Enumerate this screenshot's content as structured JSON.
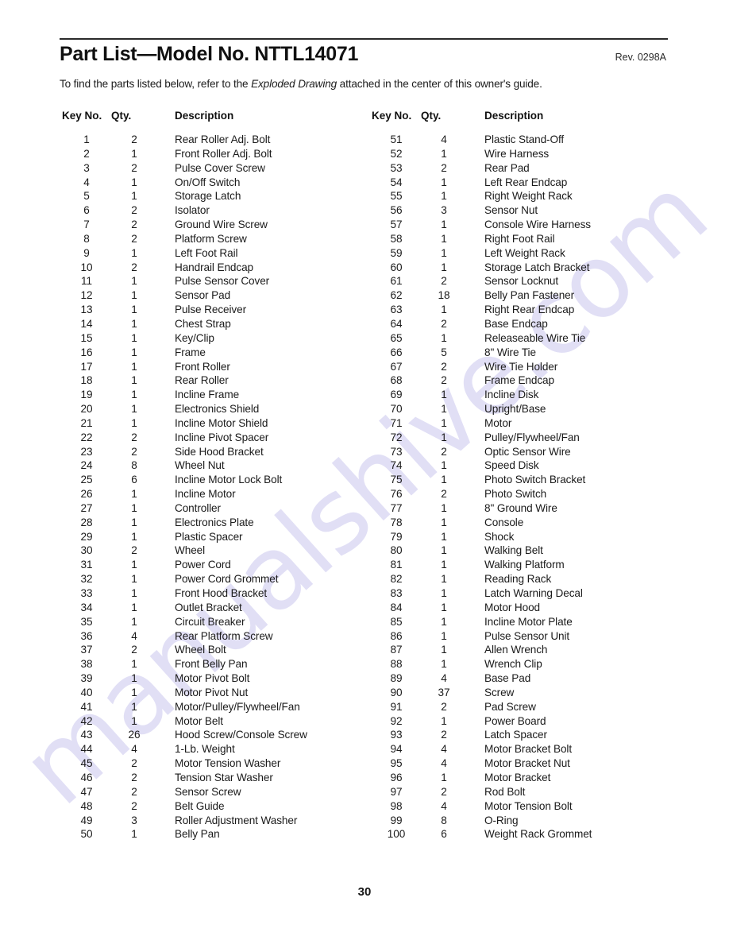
{
  "document": {
    "title": "Part List—Model No. NTTL14071",
    "revision": "Rev. 0298A",
    "intro_before": "To find the parts listed below, refer to the ",
    "intro_italic": "Exploded Drawing",
    "intro_after": " attached in the center of this owner's guide.",
    "page_number": "30",
    "watermark": "manualshive.com"
  },
  "table": {
    "headers": {
      "key_no": "Key No.",
      "qty": "Qty.",
      "description": "Description"
    },
    "left_column": [
      {
        "key": "1",
        "qty": "2",
        "desc": "Rear Roller Adj. Bolt"
      },
      {
        "key": "2",
        "qty": "1",
        "desc": "Front Roller Adj. Bolt"
      },
      {
        "key": "3",
        "qty": "2",
        "desc": "Pulse Cover Screw"
      },
      {
        "key": "4",
        "qty": "1",
        "desc": "On/Off Switch"
      },
      {
        "key": "5",
        "qty": "1",
        "desc": "Storage Latch"
      },
      {
        "key": "6",
        "qty": "2",
        "desc": "Isolator"
      },
      {
        "key": "7",
        "qty": "2",
        "desc": "Ground Wire Screw"
      },
      {
        "key": "8",
        "qty": "2",
        "desc": "Platform Screw"
      },
      {
        "key": "9",
        "qty": "1",
        "desc": "Left Foot Rail"
      },
      {
        "key": "10",
        "qty": "2",
        "desc": "Handrail Endcap"
      },
      {
        "key": "11",
        "qty": "1",
        "desc": "Pulse Sensor Cover"
      },
      {
        "key": "12",
        "qty": "1",
        "desc": "Sensor Pad"
      },
      {
        "key": "13",
        "qty": "1",
        "desc": "Pulse Receiver"
      },
      {
        "key": "14",
        "qty": "1",
        "desc": "Chest Strap"
      },
      {
        "key": "15",
        "qty": "1",
        "desc": "Key/Clip"
      },
      {
        "key": "16",
        "qty": "1",
        "desc": "Frame"
      },
      {
        "key": "17",
        "qty": "1",
        "desc": "Front Roller"
      },
      {
        "key": "18",
        "qty": "1",
        "desc": "Rear Roller"
      },
      {
        "key": "19",
        "qty": "1",
        "desc": "Incline Frame"
      },
      {
        "key": "20",
        "qty": "1",
        "desc": "Electronics Shield"
      },
      {
        "key": "21",
        "qty": "1",
        "desc": "Incline Motor Shield"
      },
      {
        "key": "22",
        "qty": "2",
        "desc": "Incline Pivot Spacer"
      },
      {
        "key": "23",
        "qty": "2",
        "desc": "Side Hood Bracket"
      },
      {
        "key": "24",
        "qty": "8",
        "desc": "Wheel Nut"
      },
      {
        "key": "25",
        "qty": "6",
        "desc": "Incline Motor Lock Bolt"
      },
      {
        "key": "26",
        "qty": "1",
        "desc": "Incline Motor"
      },
      {
        "key": "27",
        "qty": "1",
        "desc": "Controller"
      },
      {
        "key": "28",
        "qty": "1",
        "desc": "Electronics Plate"
      },
      {
        "key": "29",
        "qty": "1",
        "desc": "Plastic Spacer"
      },
      {
        "key": "30",
        "qty": "2",
        "desc": "Wheel"
      },
      {
        "key": "31",
        "qty": "1",
        "desc": "Power Cord"
      },
      {
        "key": "32",
        "qty": "1",
        "desc": "Power Cord Grommet"
      },
      {
        "key": "33",
        "qty": "1",
        "desc": "Front Hood Bracket"
      },
      {
        "key": "34",
        "qty": "1",
        "desc": "Outlet Bracket"
      },
      {
        "key": "35",
        "qty": "1",
        "desc": "Circuit Breaker"
      },
      {
        "key": "36",
        "qty": "4",
        "desc": "Rear Platform Screw"
      },
      {
        "key": "37",
        "qty": "2",
        "desc": "Wheel Bolt"
      },
      {
        "key": "38",
        "qty": "1",
        "desc": "Front Belly Pan"
      },
      {
        "key": "39",
        "qty": "1",
        "desc": "Motor Pivot Bolt"
      },
      {
        "key": "40",
        "qty": "1",
        "desc": "Motor Pivot Nut"
      },
      {
        "key": "41",
        "qty": "1",
        "desc": "Motor/Pulley/Flywheel/Fan"
      },
      {
        "key": "42",
        "qty": "1",
        "desc": "Motor Belt"
      },
      {
        "key": "43",
        "qty": "26",
        "desc": "Hood Screw/Console Screw"
      },
      {
        "key": "44",
        "qty": "4",
        "desc": "1-Lb. Weight"
      },
      {
        "key": "45",
        "qty": "2",
        "desc": "Motor Tension Washer"
      },
      {
        "key": "46",
        "qty": "2",
        "desc": "Tension Star Washer"
      },
      {
        "key": "47",
        "qty": "2",
        "desc": "Sensor Screw"
      },
      {
        "key": "48",
        "qty": "2",
        "desc": "Belt Guide"
      },
      {
        "key": "49",
        "qty": "3",
        "desc": "Roller Adjustment Washer"
      },
      {
        "key": "50",
        "qty": "1",
        "desc": "Belly Pan"
      }
    ],
    "right_column": [
      {
        "key": "51",
        "qty": "4",
        "desc": "Plastic Stand-Off"
      },
      {
        "key": "52",
        "qty": "1",
        "desc": "Wire Harness"
      },
      {
        "key": "53",
        "qty": "2",
        "desc": "Rear Pad"
      },
      {
        "key": "54",
        "qty": "1",
        "desc": "Left Rear Endcap"
      },
      {
        "key": "55",
        "qty": "1",
        "desc": "Right Weight Rack"
      },
      {
        "key": "56",
        "qty": "3",
        "desc": "Sensor Nut"
      },
      {
        "key": "57",
        "qty": "1",
        "desc": "Console Wire Harness"
      },
      {
        "key": "58",
        "qty": "1",
        "desc": "Right Foot Rail"
      },
      {
        "key": "59",
        "qty": "1",
        "desc": "Left Weight Rack"
      },
      {
        "key": "60",
        "qty": "1",
        "desc": "Storage Latch Bracket"
      },
      {
        "key": "61",
        "qty": "2",
        "desc": "Sensor Locknut"
      },
      {
        "key": "62",
        "qty": "18",
        "desc": "Belly Pan Fastener"
      },
      {
        "key": "63",
        "qty": "1",
        "desc": "Right Rear Endcap"
      },
      {
        "key": "64",
        "qty": "2",
        "desc": "Base Endcap"
      },
      {
        "key": "65",
        "qty": "1",
        "desc": "Releaseable Wire Tie"
      },
      {
        "key": "66",
        "qty": "5",
        "desc": "8\" Wire Tie"
      },
      {
        "key": "67",
        "qty": "2",
        "desc": "Wire Tie Holder"
      },
      {
        "key": "68",
        "qty": "2",
        "desc": "Frame Endcap"
      },
      {
        "key": "69",
        "qty": "1",
        "desc": "Incline Disk"
      },
      {
        "key": "70",
        "qty": "1",
        "desc": "Upright/Base"
      },
      {
        "key": "71",
        "qty": "1",
        "desc": "Motor"
      },
      {
        "key": "72",
        "qty": "1",
        "desc": "Pulley/Flywheel/Fan"
      },
      {
        "key": "73",
        "qty": "2",
        "desc": "Optic Sensor Wire"
      },
      {
        "key": "74",
        "qty": "1",
        "desc": "Speed Disk"
      },
      {
        "key": "75",
        "qty": "1",
        "desc": "Photo Switch Bracket"
      },
      {
        "key": "76",
        "qty": "2",
        "desc": "Photo Switch"
      },
      {
        "key": "77",
        "qty": "1",
        "desc": "8\" Ground Wire"
      },
      {
        "key": "78",
        "qty": "1",
        "desc": "Console"
      },
      {
        "key": "79",
        "qty": "1",
        "desc": "Shock"
      },
      {
        "key": "80",
        "qty": "1",
        "desc": "Walking Belt"
      },
      {
        "key": "81",
        "qty": "1",
        "desc": "Walking Platform"
      },
      {
        "key": "82",
        "qty": "1",
        "desc": "Reading Rack"
      },
      {
        "key": "83",
        "qty": "1",
        "desc": "Latch Warning Decal"
      },
      {
        "key": "84",
        "qty": "1",
        "desc": "Motor Hood"
      },
      {
        "key": "85",
        "qty": "1",
        "desc": "Incline Motor Plate"
      },
      {
        "key": "86",
        "qty": "1",
        "desc": "Pulse Sensor Unit"
      },
      {
        "key": "87",
        "qty": "1",
        "desc": "Allen Wrench"
      },
      {
        "key": "88",
        "qty": "1",
        "desc": "Wrench Clip"
      },
      {
        "key": "89",
        "qty": "4",
        "desc": "Base Pad"
      },
      {
        "key": "90",
        "qty": "37",
        "desc": "Screw"
      },
      {
        "key": "91",
        "qty": "2",
        "desc": "Pad Screw"
      },
      {
        "key": "92",
        "qty": "1",
        "desc": "Power Board"
      },
      {
        "key": "93",
        "qty": "2",
        "desc": "Latch Spacer"
      },
      {
        "key": "94",
        "qty": "4",
        "desc": "Motor Bracket Bolt"
      },
      {
        "key": "95",
        "qty": "4",
        "desc": "Motor Bracket Nut"
      },
      {
        "key": "96",
        "qty": "1",
        "desc": "Motor Bracket"
      },
      {
        "key": "97",
        "qty": "2",
        "desc": "Rod Bolt"
      },
      {
        "key": "98",
        "qty": "4",
        "desc": "Motor Tension Bolt"
      },
      {
        "key": "99",
        "qty": "8",
        "desc": "O-Ring"
      },
      {
        "key": "100",
        "qty": "6",
        "desc": "Weight Rack Grommet"
      }
    ]
  }
}
